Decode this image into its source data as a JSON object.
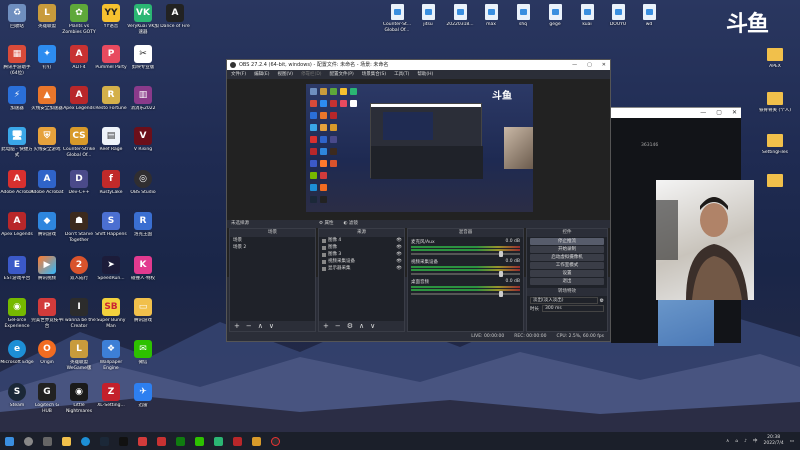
{
  "watermark": "斗鱼",
  "desktop_icons": {
    "col1": [
      "回收站",
      "腾讯手游助手(64位)",
      "加速器",
      "此电脑 - 快捷方式",
      "Adobe Acrobat",
      "Apex Legends",
      "EST游戏平台",
      "GeForce Experience",
      "Microsoft Edge",
      "Steam"
    ],
    "col2": [
      "英雄联盟",
      "钉钉",
      "火线安全加速器",
      "火线安全游戏",
      "Adobe Acrobat",
      "腾讯游戏",
      "腾讯视频",
      "完美世界竞技平台",
      "Origin",
      "Logitech G HUB"
    ],
    "col3": [
      "Plants vs Zombies GOTY",
      "ALTF4",
      "Apex Legends",
      "Counter-Strike Global Of...",
      "Dev-C++",
      "Don't Starve Together",
      "双人成行",
      "I wanna be the Creator",
      "英雄联盟 WeGame版",
      "Little Nightmares"
    ],
    "col4": [
      "YY语音",
      "Pummel Party",
      "Resto Fortune",
      "Reef Rage",
      "RustyLake",
      "Shift Happens",
      "SpeedRun...",
      "Super Bunny Man",
      "Wallpaper Engine",
      "XL-Setting..."
    ],
    "col5": [
      "VeryKuai VK加速器",
      "剪映专业版",
      "消消乐2022",
      "V Rising",
      "OBS Studio",
      "洛克王国",
      "碰撞人·特权",
      "腾讯游戏",
      "微信",
      "迅雷"
    ],
    "col6": [
      "Dance of Fire"
    ],
    "top_files": [
      "Counter-St... Global Of...",
      "jitsu",
      "20220318...",
      "max",
      "shq",
      "gege",
      "kuai",
      "DOUYU",
      "wd"
    ],
    "right_folders": [
      "APEX",
      "铁骨骨关 (个人)",
      "SettingFiles"
    ]
  },
  "obs": {
    "title": "OBS 27.2.4 (64-bit, windows) - 配置文件: 未命名 - 场景: 未命名",
    "menu": [
      "文件(F)",
      "编辑(E)",
      "视图(V)",
      "停靠栏(D)",
      "配置文件(P)",
      "场景集合(S)",
      "工具(T)",
      "帮助(H)"
    ],
    "menu_disabled_index": 3,
    "strip_label": "未选择源",
    "strip_props": "属性",
    "strip_filters": "滤镜",
    "docks": {
      "scenes": {
        "header": "场景",
        "items": [
          "场景",
          "场景 2"
        ]
      },
      "sources": {
        "header": "来源",
        "items": [
          "图像 4",
          "图像",
          "图像 3",
          "视频采集设备",
          "显示器采集"
        ]
      },
      "mixer": {
        "header": "混音器",
        "channels": [
          {
            "name": "麦克风/Aux",
            "level": "0.0 dB"
          },
          {
            "name": "视频采集设备",
            "level": "0.0 dB"
          },
          {
            "name": "桌面音频",
            "level": "0.0 dB"
          }
        ]
      },
      "controls": {
        "header": "控件",
        "buttons": [
          "停止推流",
          "开始录制",
          "启动虚拟摄像机",
          "工作室模式",
          "设置",
          "退出"
        ],
        "active_index": 0
      },
      "transitions": {
        "header": "转场特效",
        "select": "淡出(淡入淡出)",
        "duration_label": "时长",
        "duration_value": "300 ms"
      }
    },
    "status": [
      "LIVE: 00:00:00",
      "REC: 00:00:00",
      "CPU: 2.5%, 60.00 fps"
    ]
  },
  "cam_window": {
    "title_id": "363146"
  },
  "taskbar": {
    "time": "20:38",
    "date": "2022/7/4",
    "lang": "中"
  },
  "colors": {
    "obs_bg": "#2b2e38",
    "dock_bg": "#1f2229",
    "wallpaper_top": "#2a3760",
    "meter_green": "#2fae45"
  }
}
